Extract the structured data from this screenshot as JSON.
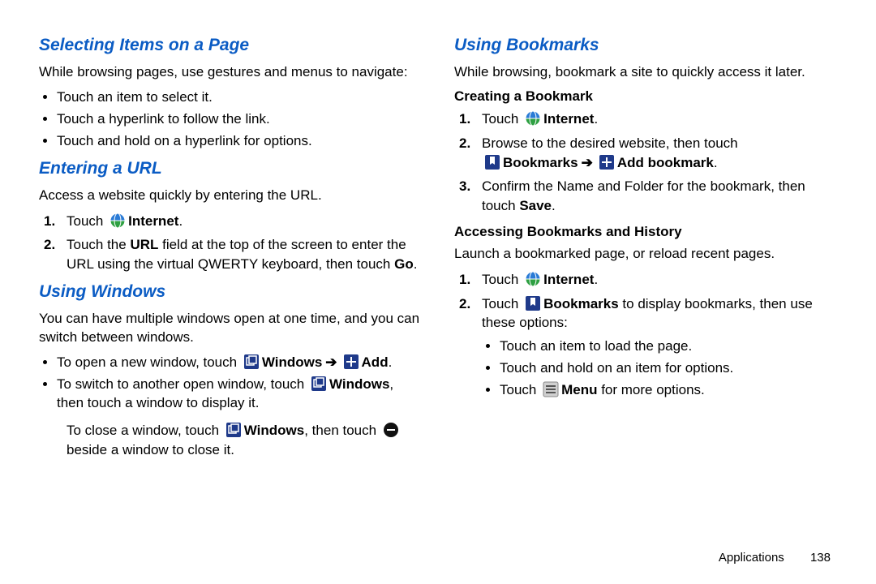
{
  "left": {
    "h1": "Selecting Items on a Page",
    "p1": "While browsing pages, use gestures and menus to navigate:",
    "bullets1": [
      "Touch an item to select it.",
      "Touch a hyperlink to follow the link.",
      "Touch and hold on a hyperlink for options."
    ],
    "h2": "Entering a URL",
    "p2": "Access a website quickly by entering the URL.",
    "ol1": {
      "s1_pre": "Touch ",
      "s1_bold": "Internet",
      "s1_post": ".",
      "s2_pre": "Touch the ",
      "s2_bold_a": "URL",
      "s2_mid": " field at the top of the screen to enter the URL using the virtual QWERTY keyboard, then touch ",
      "s2_bold_b": "Go",
      "s2_post": "."
    },
    "h3": "Using Windows",
    "p3": "You can have multiple windows open at one time, and you can switch between windows.",
    "win1_pre": "To open a new window, touch ",
    "win1_b1": "Windows",
    "win1_arrow": "➔",
    "win1_b2": "Add",
    "win1_post": ".",
    "win2_pre": "To switch to another open window, touch ",
    "win2_b1": "Windows",
    "win2_post": ", then touch a window to display it.",
    "win3_pre": "To close a window, touch ",
    "win3_b1": "Windows",
    "win3_mid": ", then touch ",
    "win3_post": " beside a window to close it."
  },
  "right": {
    "h1": "Using Bookmarks",
    "p1": "While browsing, bookmark a site to quickly access it later.",
    "h_sub1": "Creating a Bookmark",
    "create": {
      "s1_pre": "Touch ",
      "s1_bold": "Internet",
      "s1_post": ".",
      "s2_pre": "Browse to the desired website, then touch ",
      "s2_b1": "Bookmarks",
      "s2_arrow": "➔",
      "s2_b2": "Add bookmark",
      "s2_post": ".",
      "s3_pre": "Confirm the Name and Folder for the bookmark, then touch ",
      "s3_bold": "Save",
      "s3_post": "."
    },
    "h_sub2": "Accessing Bookmarks and History",
    "p2": "Launch a bookmarked page, or reload recent pages.",
    "access": {
      "s1_pre": "Touch ",
      "s1_bold": "Internet",
      "s1_post": ".",
      "s2_pre": "Touch ",
      "s2_bold": "Bookmarks",
      "s2_post": " to display bookmarks, then use these options:"
    },
    "opts_a": "Touch an item to load the page.",
    "opts_b": "Touch and hold on an item for options.",
    "opts_c_pre": "Touch ",
    "opts_c_bold": "Menu",
    "opts_c_post": " for more options."
  },
  "footer": {
    "section": "Applications",
    "page": "138"
  }
}
